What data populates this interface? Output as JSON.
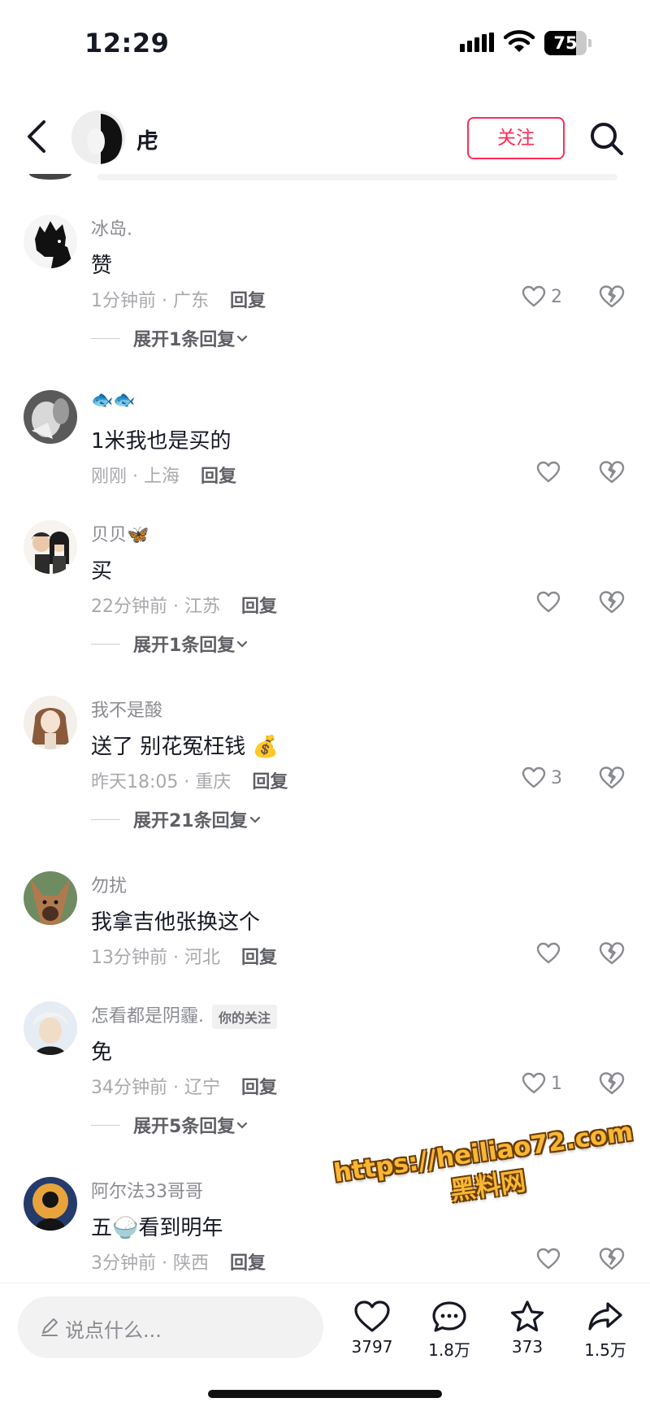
{
  "status_bar": {
    "time": "12:29",
    "battery": "75",
    "battery_level": 0.75
  },
  "header": {
    "username": "虍",
    "follow_label": "关注"
  },
  "comments": [
    {
      "name": "冰岛.",
      "text": "赞",
      "time_location": "1分钟前 · 广东",
      "reply_label": "回复",
      "likes": "2",
      "expand": "展开1条回复"
    },
    {
      "name": "🐟🐟",
      "text": "1米我也是买的",
      "time_location": "刚刚 · 上海",
      "reply_label": "回复",
      "likes": "",
      "expand": ""
    },
    {
      "name": "贝贝🦋",
      "text": "买",
      "time_location": "22分钟前 · 江苏",
      "reply_label": "回复",
      "likes": "",
      "expand": "展开1条回复"
    },
    {
      "name": "我不是酸",
      "text": "送了 别花冤枉钱 💰",
      "time_location": "昨天18:05 · 重庆",
      "reply_label": "回复",
      "likes": "3",
      "expand": "展开21条回复"
    },
    {
      "name": "勿扰",
      "text": "我拿吉他张换这个",
      "time_location": "13分钟前 · 河北",
      "reply_label": "回复",
      "likes": "",
      "expand": ""
    },
    {
      "name": "怎看都是阴霾.",
      "tag": "你的关注",
      "text": "免",
      "time_location": "34分钟前 · 辽宁",
      "reply_label": "回复",
      "likes": "1",
      "expand": "展开5条回复"
    },
    {
      "name": "阿尔法33哥哥",
      "text": "五🍚看到明年",
      "time_location": "3分钟前 · 陕西",
      "reply_label": "回复",
      "likes": "",
      "expand": ""
    }
  ],
  "watermark": {
    "line1": "https://heiliao72.com",
    "line2": "黑料网"
  },
  "bottom_bar": {
    "input_placeholder": "说点什么...",
    "like_count": "3797",
    "comment_count": "1.8万",
    "favorite_count": "373",
    "share_count": "1.5万"
  },
  "colors": {
    "accent": "#fe2c55",
    "text_primary": "#161823",
    "text_secondary": "#8a8b91"
  }
}
